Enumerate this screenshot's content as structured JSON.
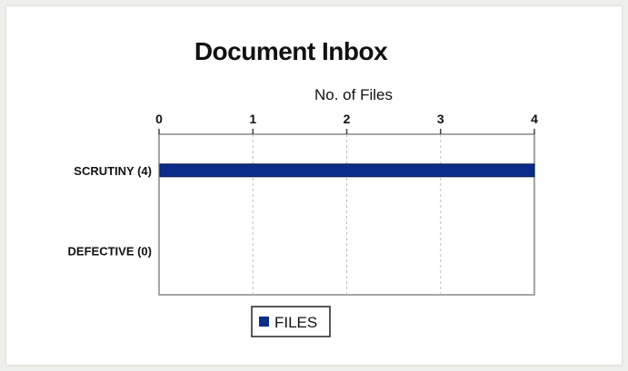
{
  "chart_data": {
    "type": "bar",
    "orientation": "horizontal",
    "title": "Document Inbox",
    "xlabel": "No. of Files",
    "ylabel": "",
    "xlim": [
      0,
      4
    ],
    "ticks": [
      0,
      1,
      2,
      3,
      4
    ],
    "categories": [
      "SCRUTINY (4)",
      "DEFECTIVE (0)"
    ],
    "series": [
      {
        "name": "FILES",
        "values": [
          4,
          0
        ],
        "color": "#0b2d8a"
      }
    ],
    "grid": true,
    "axis_position": "top",
    "legend": "bottom"
  }
}
